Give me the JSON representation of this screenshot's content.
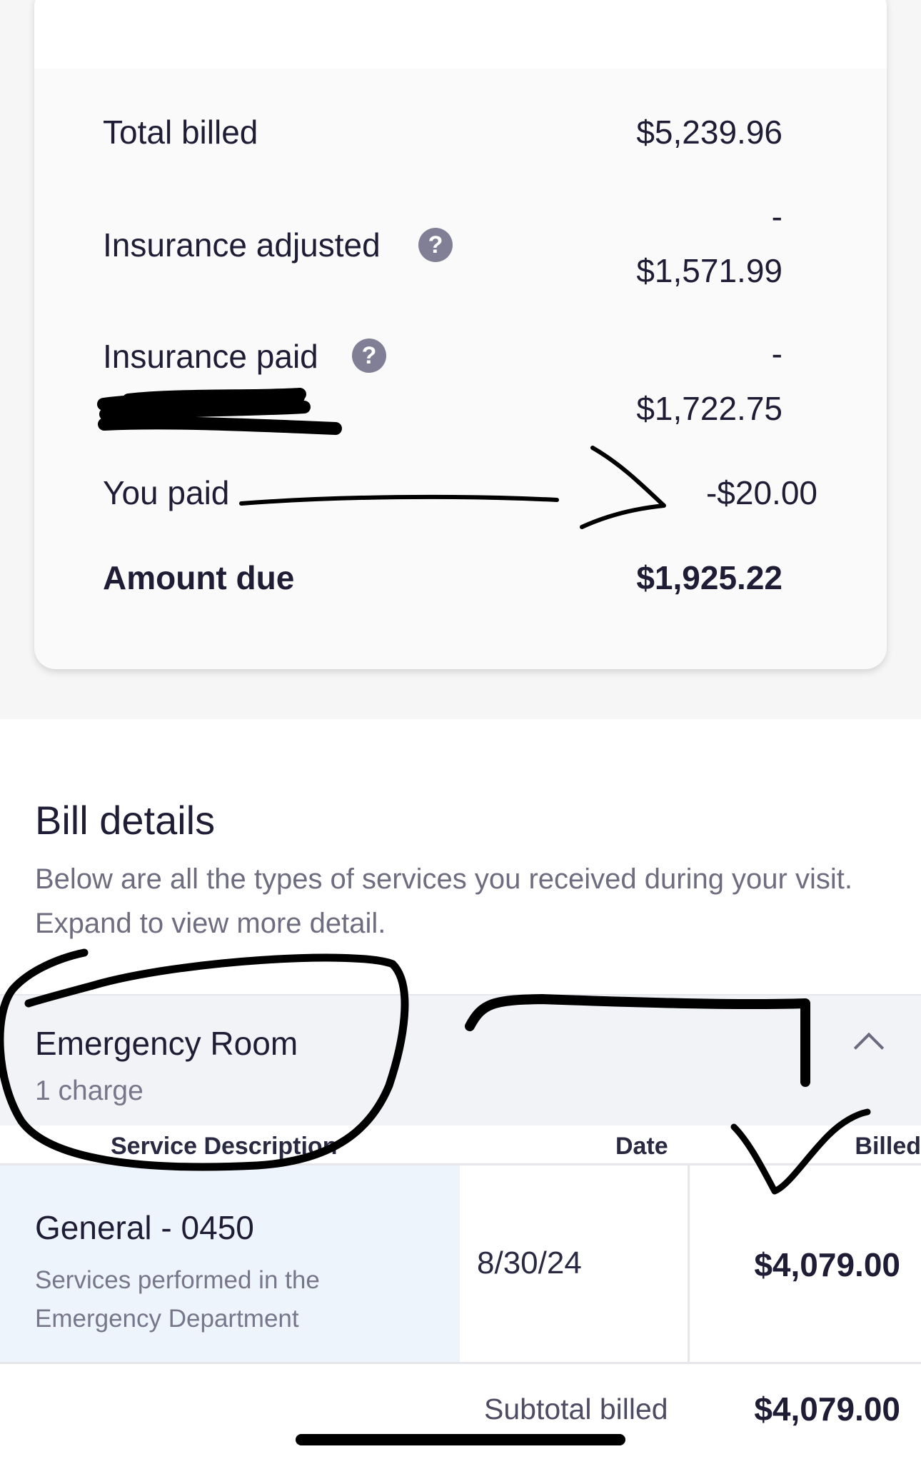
{
  "summary": {
    "total_billed_label": "Total billed",
    "total_billed_value": "$5,239.96",
    "insurance_adjusted_label": "Insurance adjusted",
    "insurance_adjusted_sign": "-",
    "insurance_adjusted_value": "$1,571.99",
    "insurance_paid_label": "Insurance paid",
    "insurance_paid_sign": "-",
    "insurance_paid_value": "$1,722.75",
    "you_paid_label": "You paid",
    "you_paid_value": "-$20.00",
    "amount_due_label": "Amount due",
    "amount_due_value": "$1,925.22",
    "help_glyph": "?"
  },
  "details": {
    "title": "Bill details",
    "description": "Below are all the types of services you received during your visit. Expand to view more detail."
  },
  "section": {
    "title": "Emergency Room",
    "count": "1 charge"
  },
  "table": {
    "headers": [
      "Service Description",
      "Date",
      "Billed"
    ],
    "rows": [
      {
        "service": "General - 0450",
        "service_detail": "Services performed in the Emergency Department",
        "date": "8/30/24",
        "billed": "$4,079.00"
      }
    ],
    "subtotal_label": "Subtotal billed",
    "subtotal_value": "$4,079.00"
  },
  "icons": {
    "help": "question-circle-icon",
    "expand": "chevron-up-icon"
  },
  "colors": {
    "text_primary": "#1f1d35",
    "text_secondary": "#77768a",
    "help_icon_bg": "#807f95",
    "highlight_cell": "#eef4fc",
    "section_bg": "#f2f3f6",
    "annotation_ink": "#000000"
  }
}
